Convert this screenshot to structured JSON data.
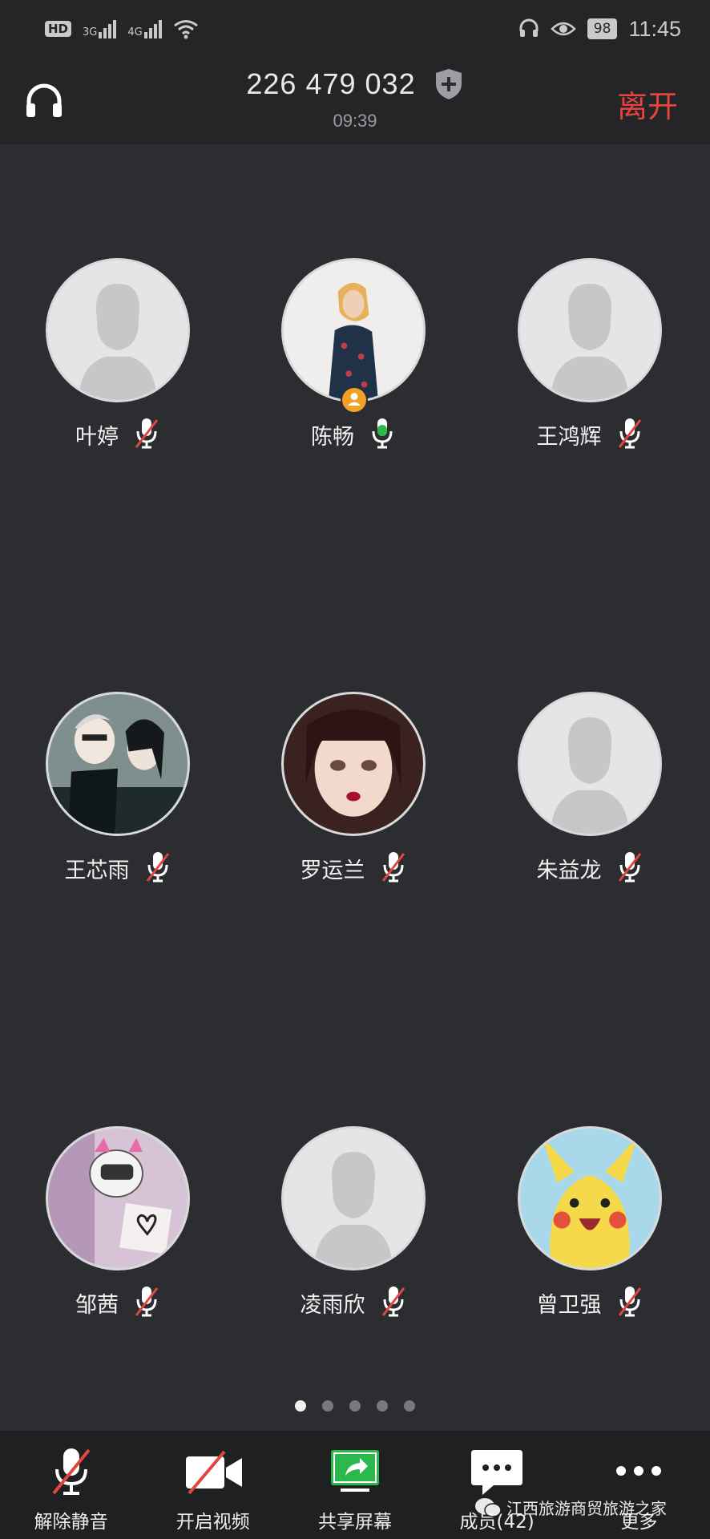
{
  "status_bar": {
    "hd_label": "HD",
    "net1": "3G",
    "net2": "4G",
    "battery": "98",
    "time": "11:45"
  },
  "header": {
    "meeting_id": "226 479 032",
    "duration": "09:39",
    "leave_label": "离开"
  },
  "participants": [
    {
      "name": "叶婷",
      "muted": true,
      "avatar": "default"
    },
    {
      "name": "陈畅",
      "muted": false,
      "avatar": "photo-woman",
      "host": true
    },
    {
      "name": "王鸿辉",
      "muted": true,
      "avatar": "default"
    },
    {
      "name": "王芯雨",
      "muted": true,
      "avatar": "anime-car"
    },
    {
      "name": "罗运兰",
      "muted": true,
      "avatar": "anime-girl"
    },
    {
      "name": "朱益龙",
      "muted": true,
      "avatar": "default"
    },
    {
      "name": "邹茜",
      "muted": true,
      "avatar": "anime-helmet"
    },
    {
      "name": "凌雨欣",
      "muted": true,
      "avatar": "default"
    },
    {
      "name": "曾卫强",
      "muted": true,
      "avatar": "pikachu"
    }
  ],
  "pager": {
    "count": 5,
    "active": 0
  },
  "toolbar": {
    "unmute_label": "解除静音",
    "video_label": "开启视频",
    "share_label": "共享屏幕",
    "members_label": "成员(42)",
    "more_label": "更多"
  },
  "watermark": {
    "text": "江西旅游商贸旅游之家"
  },
  "colors": {
    "background": "#2b2d30",
    "leave": "#e8433c",
    "mic_active": "#2db84d",
    "mute_slash": "#e0473f",
    "host_badge": "#f0a126",
    "share_green": "#2db84d"
  }
}
